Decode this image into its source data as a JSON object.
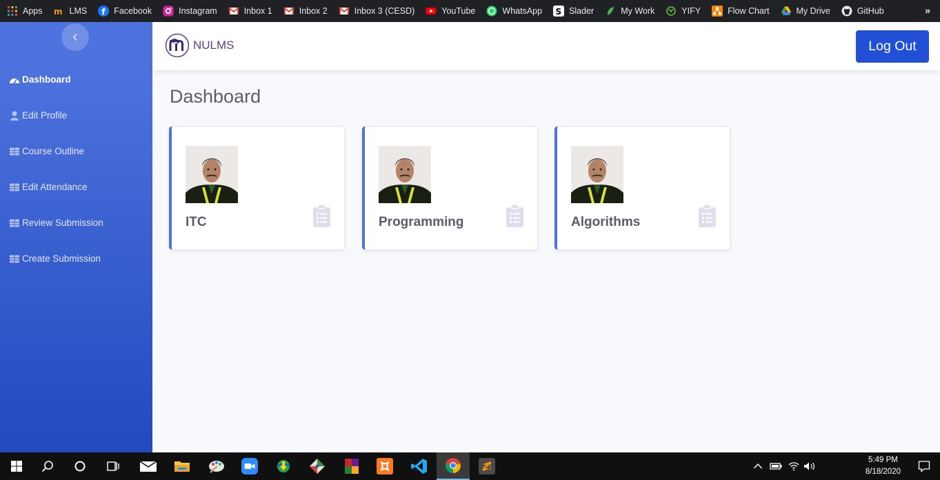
{
  "bookmarks": [
    {
      "label": "Apps",
      "icon": "apps-grid-icon",
      "color": "#e8eaed"
    },
    {
      "label": "LMS",
      "icon": "lms-icon",
      "color": "#f7941d"
    },
    {
      "label": "Facebook",
      "icon": "facebook-icon",
      "color": "#1877f2"
    },
    {
      "label": "Instagram",
      "icon": "instagram-icon",
      "color": "#d6249f"
    },
    {
      "label": "Inbox 1",
      "icon": "gmail-icon",
      "color": "#ea4335"
    },
    {
      "label": "Inbox 2",
      "icon": "gmail-icon",
      "color": "#ea4335"
    },
    {
      "label": "Inbox 3 (CESD)",
      "icon": "gmail-icon",
      "color": "#ea4335"
    },
    {
      "label": "YouTube",
      "icon": "youtube-icon",
      "color": "#ff0000"
    },
    {
      "label": "WhatsApp",
      "icon": "whatsapp-icon",
      "color": "#25d366"
    },
    {
      "label": "Slader",
      "icon": "slader-icon",
      "color": "#ffffff"
    },
    {
      "label": "My Work",
      "icon": "leaf-icon",
      "color": "#4caf50"
    },
    {
      "label": "YIFY",
      "icon": "yify-icon",
      "color": "#6ac045"
    },
    {
      "label": "Flow Chart",
      "icon": "flowchart-icon",
      "color": "#f08705"
    },
    {
      "label": "My Drive",
      "icon": "google-drive-icon",
      "color": "#fbbc04"
    },
    {
      "label": "GitHub",
      "icon": "github-icon",
      "color": "#e8eaed"
    }
  ],
  "bookmarks_more": "»",
  "brand": {
    "name": "NULMS"
  },
  "logout_label": "Log Out",
  "sidebar": {
    "items": [
      {
        "label": "Dashboard",
        "icon": "tachometer-icon",
        "active": true
      },
      {
        "label": "Edit Profile",
        "icon": "user-icon",
        "active": false
      },
      {
        "label": "Course Outline",
        "icon": "table-icon",
        "active": false
      },
      {
        "label": "Edit Attendance",
        "icon": "table-icon",
        "active": false
      },
      {
        "label": "Review Submission",
        "icon": "table-icon",
        "active": false
      },
      {
        "label": "Create Submission",
        "icon": "table-icon",
        "active": false
      }
    ]
  },
  "page_title": "Dashboard",
  "courses": [
    {
      "title": "ITC"
    },
    {
      "title": "Programming"
    },
    {
      "title": "Algorithms"
    }
  ],
  "colors": {
    "primary": "#4e73df",
    "primary_dark": "#224abe",
    "logout": "#2150d6",
    "text": "#5a5c69"
  },
  "taskbar": {
    "time": "5:49 PM",
    "date": "8/18/2020",
    "apps": [
      "windows-start-icon",
      "search-icon",
      "cortana-icon",
      "task-view-icon",
      "mail-icon",
      "file-explorer-icon",
      "paint-icon",
      "zoom-icon",
      "idm-icon",
      "git-icon",
      "winrar-icon",
      "xampp-icon",
      "vscode-icon",
      "chrome-icon",
      "sublime-icon"
    ]
  }
}
